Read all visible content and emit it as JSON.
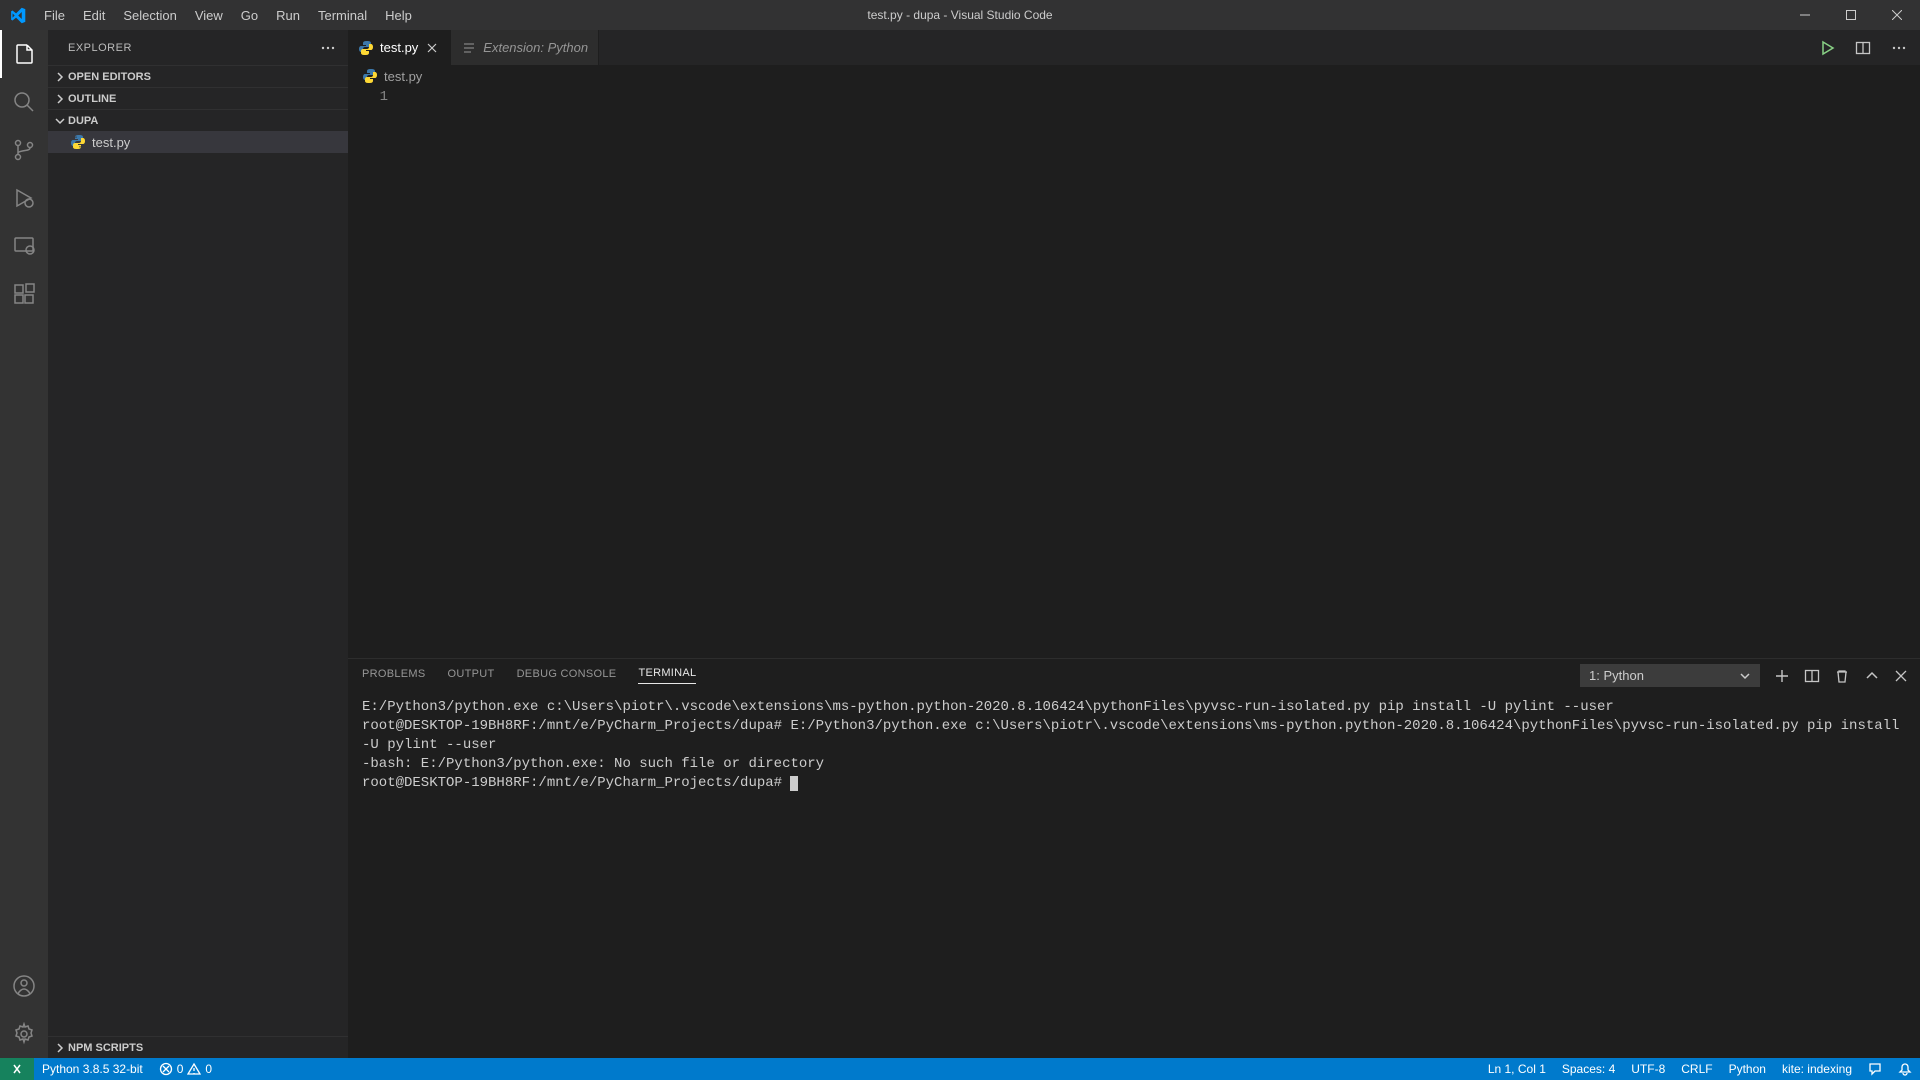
{
  "window": {
    "title": "test.py - dupa - Visual Studio Code"
  },
  "menu": [
    "File",
    "Edit",
    "Selection",
    "View",
    "Go",
    "Run",
    "Terminal",
    "Help"
  ],
  "sidebar": {
    "title": "EXPLORER",
    "sections": {
      "openEditors": "OPEN EDITORS",
      "outline": "OUTLINE",
      "folder": "DUPA",
      "npm": "NPM SCRIPTS"
    },
    "file": "test.py"
  },
  "tabs": {
    "t1": "test.py",
    "t2": "Extension: Python"
  },
  "breadcrumb": "test.py",
  "editor": {
    "line1": "1"
  },
  "panel": {
    "tabs": {
      "problems": "PROBLEMS",
      "output": "OUTPUT",
      "debug": "DEBUG CONSOLE",
      "terminal": "TERMINAL"
    },
    "terminalSelect": "1: Python",
    "terminalText": "E:/Python3/python.exe c:\\Users\\piotr\\.vscode\\extensions\\ms-python.python-2020.8.106424\\pythonFiles\\pyvsc-run-isolated.py pip install -U pylint --user\nroot@DESKTOP-19BH8RF:/mnt/e/PyCharm_Projects/dupa# E:/Python3/python.exe c:\\Users\\piotr\\.vscode\\extensions\\ms-python.python-2020.8.106424\\pythonFiles\\pyvsc-run-isolated.py pip install -U pylint --user\n-bash: E:/Python3/python.exe: No such file or directory\nroot@DESKTOP-19BH8RF:/mnt/e/PyCharm_Projects/dupa# "
  },
  "status": {
    "python": "Python 3.8.5 32-bit",
    "errors": "0",
    "warnings": "0",
    "lncol": "Ln 1, Col 1",
    "spaces": "Spaces: 4",
    "encoding": "UTF-8",
    "eol": "CRLF",
    "lang": "Python",
    "kite": "kite: indexing"
  }
}
